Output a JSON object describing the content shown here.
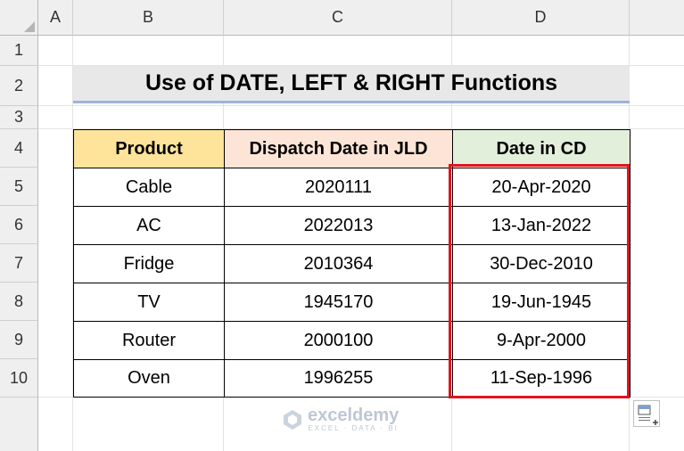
{
  "sheet": {
    "columns": [
      "A",
      "B",
      "C",
      "D"
    ],
    "rows": [
      "1",
      "2",
      "3",
      "4",
      "5",
      "6",
      "7",
      "8",
      "9",
      "10"
    ]
  },
  "title": "Use of DATE, LEFT & RIGHT Functions",
  "table": {
    "headers": [
      "Product",
      "Dispatch Date in JLD",
      "Date in CD"
    ],
    "header_colors": [
      "#fde49a",
      "#fce4d6",
      "#e2efda"
    ],
    "rows": [
      [
        "Cable",
        "2020111",
        "20-Apr-2020"
      ],
      [
        "AC",
        "2022013",
        "13-Jan-2022"
      ],
      [
        "Fridge",
        "2010364",
        "30-Dec-2010"
      ],
      [
        "TV",
        "1945170",
        "19-Jun-1945"
      ],
      [
        "Router",
        "2000100",
        "9-Apr-2000"
      ],
      [
        "Oven",
        "1996255",
        "11-Sep-1996"
      ]
    ]
  },
  "highlight_color": "#e0151f",
  "watermark": {
    "name": "exceldemy",
    "tagline": "EXCEL · DATA · BI"
  }
}
